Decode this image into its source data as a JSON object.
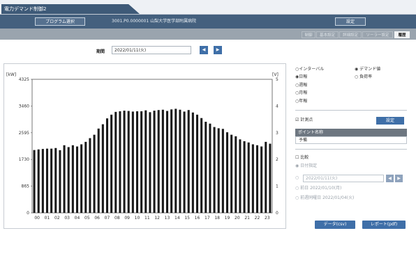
{
  "window": {
    "tab_title": "電力デマンド制御2"
  },
  "toolbar": {
    "program_select_label": "プログラム選択",
    "path_text": "3001.P0.0000001 山梨大学医学部附属病院",
    "settings_label": "設定"
  },
  "subtabs": [
    {
      "label": "制御",
      "active": false
    },
    {
      "label": "基本設定",
      "active": false
    },
    {
      "label": "詳細設定",
      "active": false
    },
    {
      "label": "ソーラー設定",
      "active": false
    },
    {
      "label": "履歴",
      "active": true
    }
  ],
  "period": {
    "label": "期間",
    "value": "2022/01/11(火)",
    "prev_icon": "triangle-left-icon",
    "next_icon": "triangle-right-icon"
  },
  "chart_data": {
    "type": "bar",
    "ylabel_left": "[kW]",
    "ylabel_right": "[V]",
    "categories": [
      "00",
      "01",
      "02",
      "03",
      "04",
      "05",
      "06",
      "07",
      "08",
      "09",
      "10",
      "11",
      "12",
      "13",
      "14",
      "15",
      "16",
      "17",
      "18",
      "19",
      "20",
      "21",
      "22",
      "23"
    ],
    "series": [
      {
        "values": [
          2035,
          2055,
          2070,
          2080,
          2080,
          2100,
          2030,
          2190,
          2130,
          2190,
          2150,
          2220,
          2300,
          2420,
          2530,
          2730,
          2870,
          3060,
          3180,
          3270,
          3290,
          3310,
          3300,
          3280,
          3290,
          3290,
          3320,
          3260,
          3310,
          3330,
          3340,
          3300,
          3350,
          3370,
          3340,
          3280,
          3330,
          3250,
          3180,
          3070,
          2950,
          2890,
          2780,
          2740,
          2720,
          2610,
          2530,
          2480,
          2380,
          2320,
          2280,
          2220,
          2190,
          2150,
          2300,
          2240
        ]
      }
    ],
    "bars_per_hour": 2,
    "yticks_left": [
      "4325",
      "3460",
      "2595",
      "1730",
      "865",
      "0"
    ],
    "yticks_right": [
      "5",
      "4",
      "3",
      "2",
      "1",
      "0"
    ],
    "ylim": [
      0,
      4325
    ],
    "grid": false,
    "bar_color": "#1a1a1a"
  },
  "panel": {
    "interval_radio": "インターバル",
    "demand_radio": "デマンド値",
    "daily_radio": "日報",
    "load_radio": "負荷率",
    "weekly_radio": "週報",
    "monthly_radio": "月報",
    "yearly_radio": "年報",
    "measure_checkbox": "計測点",
    "measure_settings": "設定",
    "table_header": "ポイント名称",
    "table_row": "予備",
    "compare_checkbox": "比較",
    "compare_date_radio": "日付指定",
    "compare_date_value": "2022/01/11(火)",
    "prev_day_radio": "前日 2022/01/10(月)",
    "prev_week_radio": "前週同曜日 2022/01/04(火)",
    "data_csv_button": "データ(csv)",
    "report_pdf_button": "レポート(pdf)"
  }
}
